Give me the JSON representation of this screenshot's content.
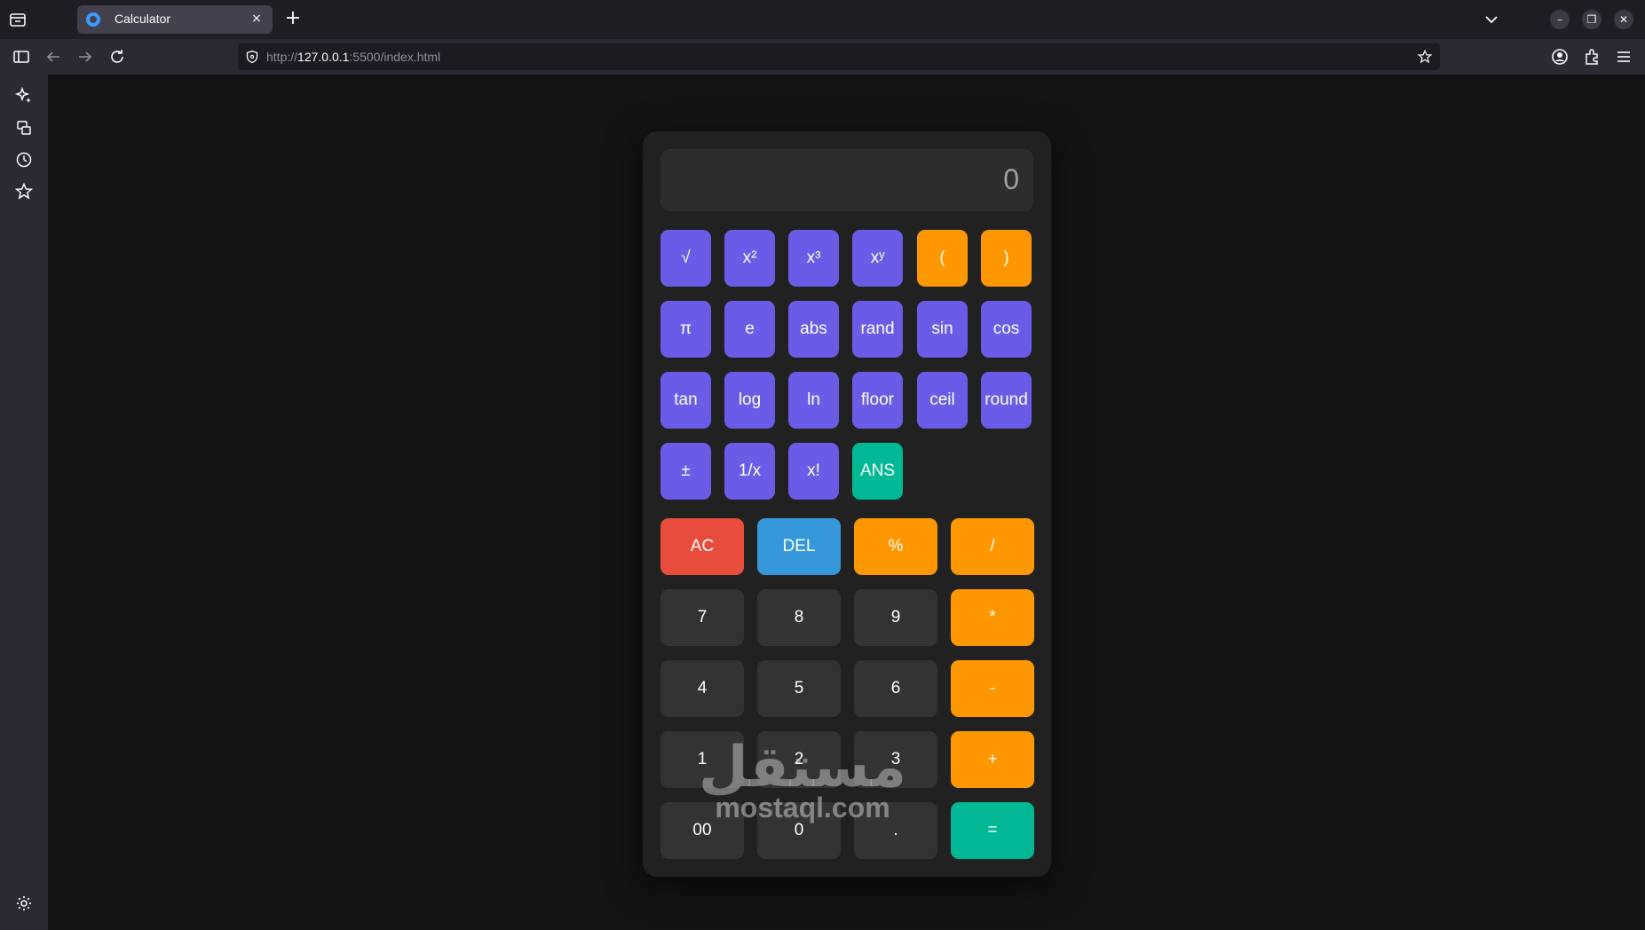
{
  "browser": {
    "tab_title": "Calculator",
    "tab_close": "×",
    "new_tab": "+",
    "url_scheme": "http://",
    "url_host": "127.0.0.1",
    "url_rest": ":5500/index.html"
  },
  "calculator": {
    "display": "0",
    "sci_rows": [
      [
        {
          "label": "√",
          "kind": "sci"
        },
        {
          "label": "x²",
          "kind": "sci"
        },
        {
          "label": "x³",
          "kind": "sci"
        },
        {
          "label": "xʸ",
          "kind": "sci"
        },
        {
          "label": "(",
          "kind": "paren"
        },
        {
          "label": ")",
          "kind": "paren"
        }
      ],
      [
        {
          "label": "π",
          "kind": "sci"
        },
        {
          "label": "e",
          "kind": "sci"
        },
        {
          "label": "abs",
          "kind": "sci"
        },
        {
          "label": "rand",
          "kind": "sci"
        },
        {
          "label": "sin",
          "kind": "sci"
        },
        {
          "label": "cos",
          "kind": "sci"
        }
      ],
      [
        {
          "label": "tan",
          "kind": "sci"
        },
        {
          "label": "log",
          "kind": "sci"
        },
        {
          "label": "ln",
          "kind": "sci"
        },
        {
          "label": "floor",
          "kind": "sci"
        },
        {
          "label": "ceil",
          "kind": "sci"
        },
        {
          "label": "round",
          "kind": "sci"
        }
      ],
      [
        {
          "label": "±",
          "kind": "sci"
        },
        {
          "label": "1/x",
          "kind": "sci"
        },
        {
          "label": "x!",
          "kind": "sci"
        },
        {
          "label": "ANS",
          "kind": "ans"
        }
      ]
    ],
    "main_rows": [
      [
        {
          "label": "AC",
          "kind": "ac"
        },
        {
          "label": "DEL",
          "kind": "del"
        },
        {
          "label": "%",
          "kind": "op"
        },
        {
          "label": "/",
          "kind": "op"
        }
      ],
      [
        {
          "label": "7",
          "kind": "num"
        },
        {
          "label": "8",
          "kind": "num"
        },
        {
          "label": "9",
          "kind": "num"
        },
        {
          "label": "*",
          "kind": "op"
        }
      ],
      [
        {
          "label": "4",
          "kind": "num"
        },
        {
          "label": "5",
          "kind": "num"
        },
        {
          "label": "6",
          "kind": "num"
        },
        {
          "label": "-",
          "kind": "op"
        }
      ],
      [
        {
          "label": "1",
          "kind": "num"
        },
        {
          "label": "2",
          "kind": "num"
        },
        {
          "label": "3",
          "kind": "num"
        },
        {
          "label": "+",
          "kind": "op"
        }
      ],
      [
        {
          "label": "00",
          "kind": "num"
        },
        {
          "label": "0",
          "kind": "num"
        },
        {
          "label": ".",
          "kind": "num"
        },
        {
          "label": "=",
          "kind": "eq"
        }
      ]
    ]
  },
  "watermark": {
    "arabic": "مستقل",
    "latin": "mostaql.com"
  },
  "colors": {
    "sci": "#6b5ce7",
    "orange": "#ff9800",
    "green": "#00b894",
    "red": "#e74c3c",
    "blue": "#3498db",
    "num": "#333333"
  }
}
